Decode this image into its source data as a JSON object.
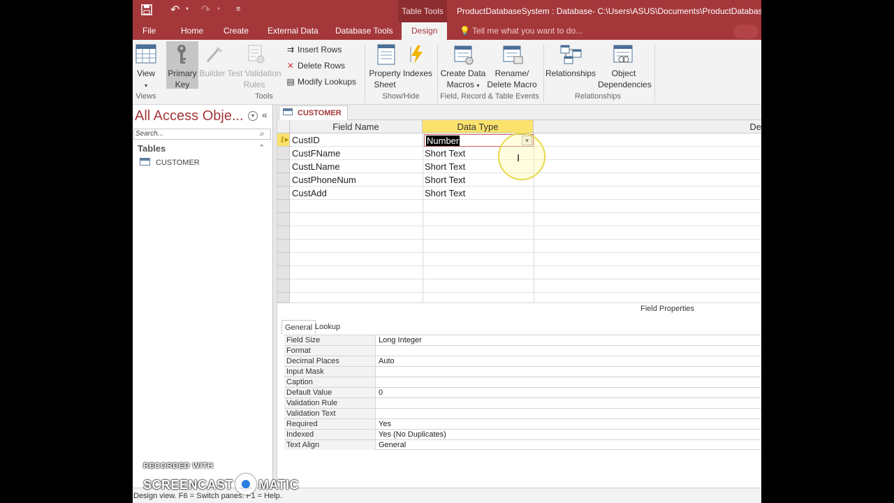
{
  "titlebar": {
    "context_tab": "Table Tools",
    "title": "ProductDatabaseSystem : Database- C:\\Users\\ASUS\\Documents\\ProductDatabaseSy"
  },
  "tabs": [
    "File",
    "Home",
    "Create",
    "External Data",
    "Database Tools",
    "Design"
  ],
  "tell_me": "Tell me what you want to do...",
  "ribbon": {
    "view": "View",
    "primary_key": [
      "Primary",
      "Key"
    ],
    "builder": "Builder",
    "test_validation": [
      "Test Validation",
      "Rules"
    ],
    "insert_rows": "Insert Rows",
    "delete_rows": "Delete Rows",
    "modify_lookups": "Modify Lookups",
    "property_sheet": [
      "Property",
      "Sheet"
    ],
    "indexes": "Indexes",
    "create_data_macros": [
      "Create Data",
      "Macros"
    ],
    "rename_delete_macro": [
      "Rename/",
      "Delete Macro"
    ],
    "relationships": "Relationships",
    "object_dependencies": [
      "Object",
      "Dependencies"
    ],
    "groups": {
      "views": "Views",
      "tools": "Tools",
      "show_hide": "Show/Hide",
      "field_events": "Field, Record & Table Events",
      "relationships": "Relationships"
    }
  },
  "nav": {
    "title": "All Access Obje...",
    "search_placeholder": "Search...",
    "group": "Tables",
    "items": [
      "CUSTOMER"
    ]
  },
  "document": {
    "tab": "CUSTOMER",
    "headers": {
      "field_name": "Field Name",
      "data_type": "Data Type",
      "description": "De"
    },
    "rows": [
      {
        "field": "CustID",
        "type": "Number"
      },
      {
        "field": "CustFName",
        "type": "Short Text"
      },
      {
        "field": "CustLName",
        "type": "Short Text"
      },
      {
        "field": "CustPhoneNum",
        "type": "Short Text"
      },
      {
        "field": "CustAdd",
        "type": "Short Text"
      }
    ]
  },
  "field_properties": {
    "title": "Field Properties",
    "tabs": [
      "General",
      "Lookup"
    ],
    "rows": [
      {
        "label": "Field Size",
        "value": "Long Integer"
      },
      {
        "label": "Format",
        "value": ""
      },
      {
        "label": "Decimal Places",
        "value": "Auto"
      },
      {
        "label": "Input Mask",
        "value": ""
      },
      {
        "label": "Caption",
        "value": ""
      },
      {
        "label": "Default Value",
        "value": "0"
      },
      {
        "label": "Validation Rule",
        "value": ""
      },
      {
        "label": "Validation Text",
        "value": ""
      },
      {
        "label": "Required",
        "value": "Yes"
      },
      {
        "label": "Indexed",
        "value": "Yes (No Duplicates)"
      },
      {
        "label": "Text Align",
        "value": "General"
      }
    ]
  },
  "status": "Design view.  F6 = Switch panes.  F1 = Help.",
  "watermark": {
    "line1": "RECORDED WITH",
    "left": "SCREENCAST",
    "right": "MATIC"
  },
  "colors": {
    "accent": "#a4373a",
    "selected_header": "#fbe26d"
  }
}
